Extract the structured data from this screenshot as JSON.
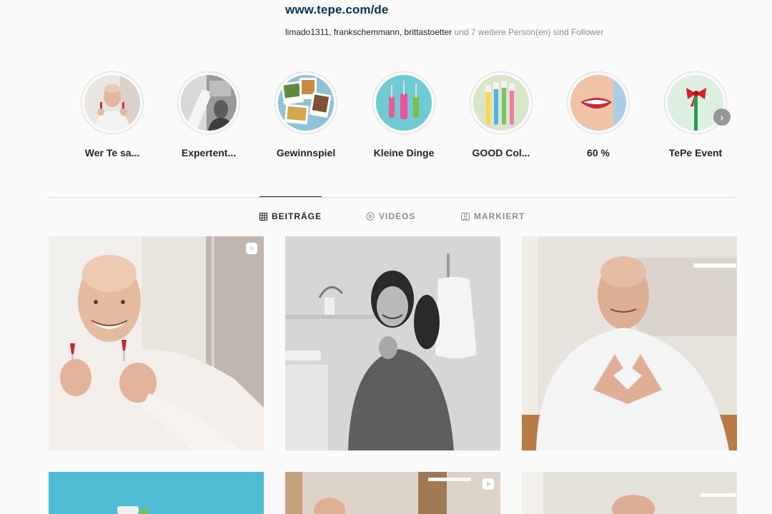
{
  "profile": {
    "website": "www.tepe.com/de",
    "followed_by_names": "limado1311, frankschemmann, brittastoetter",
    "followed_by_suffix": " und 7 weitere Person(en) sind Follower"
  },
  "highlights": [
    {
      "label": "Wer Te sa...",
      "icon": "man-with-brushes-photo"
    },
    {
      "label": "Expertent...",
      "icon": "expert-photo"
    },
    {
      "label": "Gewinnspiel",
      "icon": "photo-collage"
    },
    {
      "label": "Kleine Dinge",
      "icon": "interdental-brushes"
    },
    {
      "label": "GOOD Col...",
      "icon": "toothbrushes"
    },
    {
      "label": "60 %",
      "icon": "smile-lips"
    },
    {
      "label": "TePe Event",
      "icon": "brush-with-bow"
    }
  ],
  "tabs": [
    {
      "label": "BEITRÄGE",
      "icon": "grid-icon",
      "active": true
    },
    {
      "label": "VIDEOS",
      "icon": "play-circle-icon",
      "active": false
    },
    {
      "label": "MARKIERT",
      "icon": "tagged-icon",
      "active": false
    }
  ],
  "posts": [
    {
      "subject": "bald man smiling holding red interdental brushes",
      "type": "reel"
    },
    {
      "subject": "woman in bathroom black-and-white",
      "type": "photo"
    },
    {
      "subject": "man making heart with hands",
      "type": "photo"
    },
    {
      "subject": "toothbrushes on blue background",
      "type": "photo"
    },
    {
      "subject": "man in bathroom mirror",
      "type": "reel"
    },
    {
      "subject": "man in bathroom",
      "type": "photo"
    }
  ],
  "colors": {
    "link": "#00376b",
    "muted": "#8e8e8e",
    "text": "#262626",
    "border": "#dbdbdb"
  }
}
